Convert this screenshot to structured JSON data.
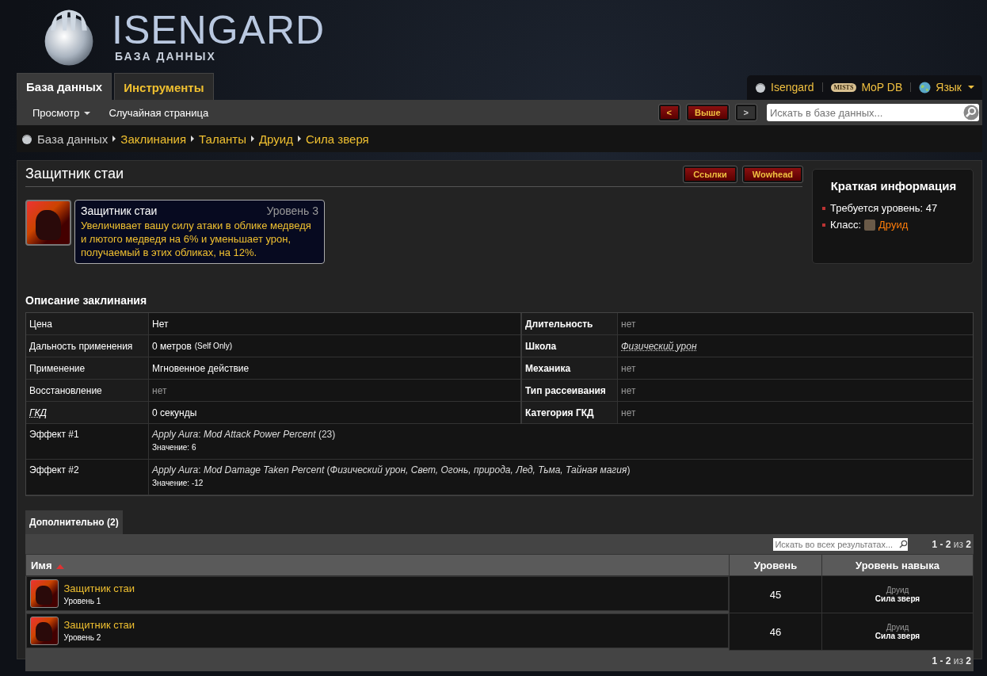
{
  "logo": {
    "title": "ISENGARD",
    "subtitle": "БАЗА ДАННЫХ"
  },
  "main_tabs": [
    {
      "label": "База данных",
      "selected": true
    },
    {
      "label": "Инструменты",
      "selected": false
    }
  ],
  "top_links": [
    {
      "kind": "isengard",
      "label": "Isengard"
    },
    {
      "kind": "mists",
      "label": "MoP DB",
      "badge": "MISTS"
    },
    {
      "kind": "globe",
      "label": "Язык",
      "dropdown": true
    }
  ],
  "sub_menu": [
    {
      "label": "Просмотр",
      "dropdown": true
    },
    {
      "label": "Случайная страница",
      "dropdown": false
    }
  ],
  "nav_buttons": [
    {
      "label": "<",
      "kind": "red"
    },
    {
      "label": "Выше",
      "kind": "red"
    },
    {
      "label": ">",
      "kind": "grey"
    }
  ],
  "search": {
    "placeholder": "Искать в базе данных..."
  },
  "breadcrumbs": [
    "База данных",
    "Заклинания",
    "Таланты",
    "Друид",
    "Сила зверя"
  ],
  "page_title": "Защитник стаи",
  "title_buttons": [
    "Ссылки",
    "Wowhead"
  ],
  "tooltip": {
    "name": "Защитник стаи",
    "rank": "Уровень 3",
    "text": "Увеличивает вашу силу атаки в облике медведя и лютого медведя на 6% и уменьшает урон, получаемый в этих обликах, на 12%."
  },
  "infobox": {
    "title": "Краткая информация",
    "items": [
      {
        "kind": "text",
        "text": "Требуется уровень: 47"
      },
      {
        "kind": "class",
        "label": "Класс:",
        "value": "Друид"
      }
    ]
  },
  "details_title": "Описание заклинания",
  "details_left": [
    {
      "label": "Цена",
      "value": "Нет",
      "muted": false,
      "link": false
    },
    {
      "label": "Дальность применения",
      "value": "0 метров",
      "note": "(Self Only)",
      "muted": false,
      "link": false
    },
    {
      "label": "Применение",
      "value": "Мгновенное действие",
      "muted": false,
      "link": false
    },
    {
      "label": "Восстановление",
      "value": "нет",
      "muted": true,
      "link": false
    },
    {
      "label": "ГКД",
      "value": "0 секунды",
      "muted": false,
      "link": true
    }
  ],
  "details_right": [
    {
      "label": "Длительность",
      "value": "нет",
      "muted": true,
      "link": false
    },
    {
      "label": "Школа",
      "value": "Физический урон",
      "muted": false,
      "link": true
    },
    {
      "label": "Механика",
      "value": "нет",
      "muted": true,
      "link": false
    },
    {
      "label": "Тип рассеивания",
      "value": "нет",
      "muted": true,
      "link": false
    },
    {
      "label": "Категория ГКД",
      "value": "нет",
      "muted": true,
      "link": false
    }
  ],
  "effects": [
    {
      "label": "Эффект #1",
      "text": "*Apply Aura*: *Mod Attack Power Percent* (23)",
      "value": "Значение: 6"
    },
    {
      "label": "Эффект #2",
      "text": "*Apply Aura*: *Mod Damage Taken Percent* (*Физический урон, Свет, Огонь, природа, Лед, Тьма, Тайная магия*)",
      "value": "Значение: -12"
    }
  ],
  "results_tabs": [
    {
      "label": "Дополнительно (2)",
      "selected": true
    }
  ],
  "results_filter": {
    "placeholder": "Искать во всех результатах..."
  },
  "pagination_top": "**1 - 2** из **2**",
  "table": {
    "columns": [
      {
        "label": "Имя",
        "sorted": true
      },
      {
        "label": "Уровень",
        "sorted": false
      },
      {
        "label": "Уровень навыка",
        "sorted": false
      }
    ],
    "rows": [
      {
        "name": "Защитник стаи",
        "rank": "Уровень 1",
        "level": "45",
        "skill_class": "Друид",
        "skill_tree": "Сила зверя"
      },
      {
        "name": "Защитник стаи",
        "rank": "Уровень 2",
        "level": "46",
        "skill_class": "Друид",
        "skill_tree": "Сила зверя"
      }
    ]
  },
  "pagination_bottom": "**1 - 2** из **2**"
}
